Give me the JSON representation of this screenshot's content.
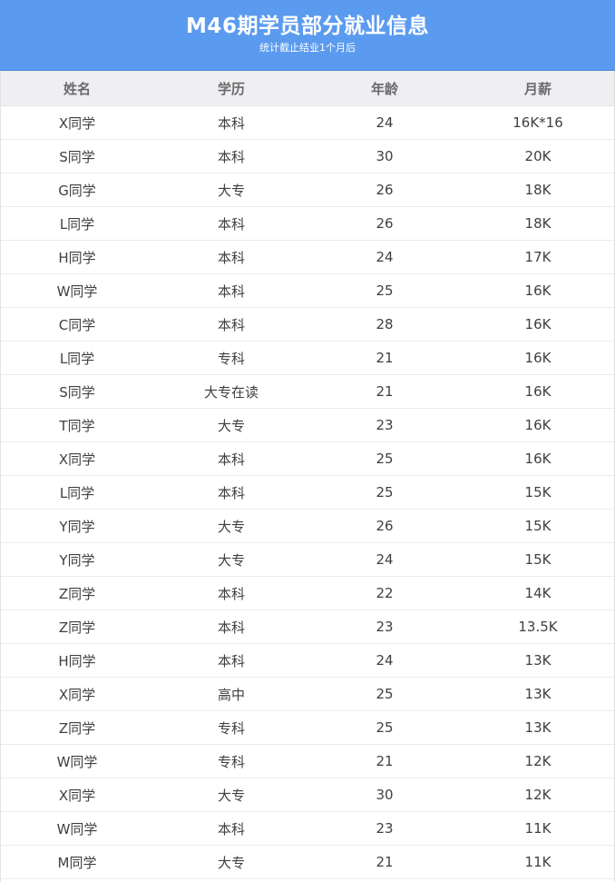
{
  "header": {
    "title": "M46期学员部分就业信息",
    "subtitle": "统计截止结业1个月后",
    "background": "#5b9bef"
  },
  "table": {
    "columns": [
      "姓名",
      "学历",
      "年龄",
      "月薪"
    ],
    "rows": [
      [
        "X同学",
        "本科",
        "24",
        "16K*16"
      ],
      [
        "S同学",
        "本科",
        "30",
        "20K"
      ],
      [
        "G同学",
        "大专",
        "26",
        "18K"
      ],
      [
        "L同学",
        "本科",
        "26",
        "18K"
      ],
      [
        "H同学",
        "本科",
        "24",
        "17K"
      ],
      [
        "W同学",
        "本科",
        "25",
        "16K"
      ],
      [
        "C同学",
        "本科",
        "28",
        "16K"
      ],
      [
        "L同学",
        "专科",
        "21",
        "16K"
      ],
      [
        "S同学",
        "大专在读",
        "21",
        "16K"
      ],
      [
        "T同学",
        "大专",
        "23",
        "16K"
      ],
      [
        "X同学",
        "本科",
        "25",
        "16K"
      ],
      [
        "L同学",
        "本科",
        "25",
        "15K"
      ],
      [
        "Y同学",
        "大专",
        "26",
        "15K"
      ],
      [
        "Y同学",
        "大专",
        "24",
        "15K"
      ],
      [
        "Z同学",
        "本科",
        "22",
        "14K"
      ],
      [
        "Z同学",
        "本科",
        "23",
        "13.5K"
      ],
      [
        "H同学",
        "本科",
        "24",
        "13K"
      ],
      [
        "X同学",
        "高中",
        "25",
        "13K"
      ],
      [
        "Z同学",
        "专科",
        "25",
        "13K"
      ],
      [
        "W同学",
        "专科",
        "21",
        "12K"
      ],
      [
        "X同学",
        "大专",
        "30",
        "12K"
      ],
      [
        "W同学",
        "本科",
        "23",
        "11K"
      ],
      [
        "M同学",
        "大专",
        "21",
        "11K"
      ]
    ]
  }
}
